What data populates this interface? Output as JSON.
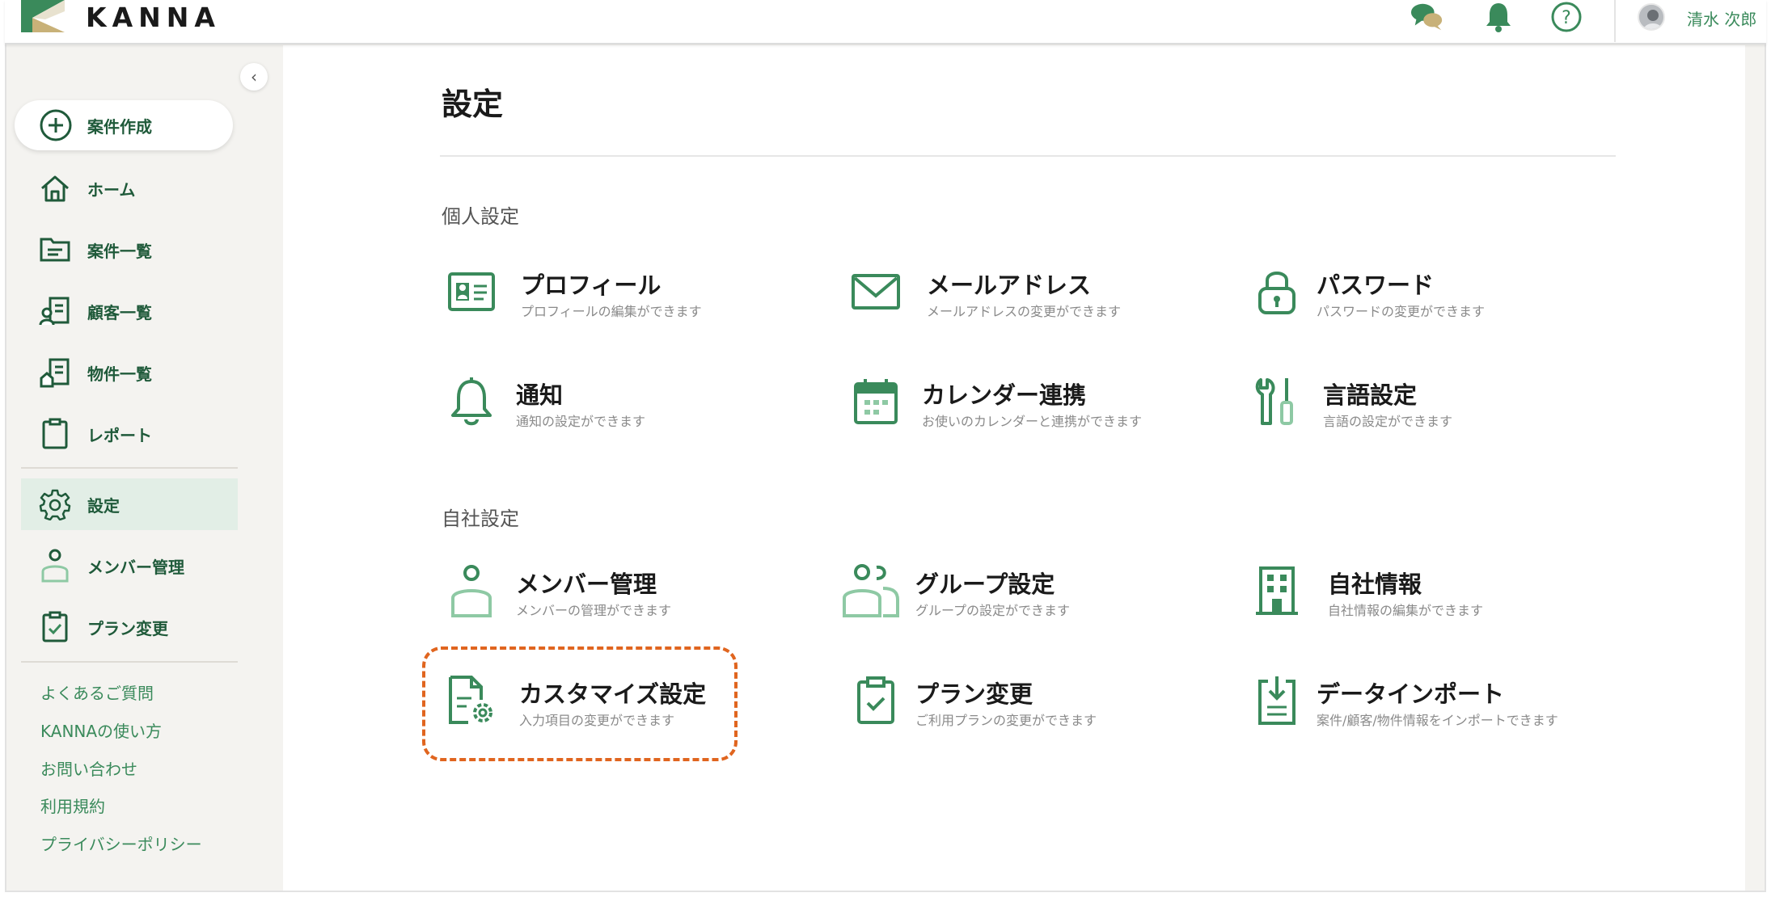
{
  "header": {
    "brand": "KANNA",
    "user_name": "清水 次郎",
    "icons": [
      "chat-icon",
      "bell-icon",
      "help-icon"
    ]
  },
  "sidebar": {
    "collapse_icon": "‹",
    "create_label": "案件作成",
    "items": [
      {
        "label": "ホーム",
        "icon": "home-icon"
      },
      {
        "label": "案件一覧",
        "icon": "folder-icon"
      },
      {
        "label": "顧客一覧",
        "icon": "customer-icon"
      },
      {
        "label": "物件一覧",
        "icon": "property-icon"
      },
      {
        "label": "レポート",
        "icon": "clipboard-icon"
      },
      {
        "label": "設定",
        "icon": "gear-icon",
        "active": true
      },
      {
        "label": "メンバー管理",
        "icon": "user-icon"
      },
      {
        "label": "プラン変更",
        "icon": "clipboard-check-icon"
      }
    ],
    "links": [
      "よくあるご質問",
      "KANNAの使い方",
      "お問い合わせ",
      "利用規約",
      "プライバシーポリシー"
    ]
  },
  "main": {
    "title": "設定",
    "personal": {
      "heading": "個人設定",
      "cards": [
        {
          "title": "プロフィール",
          "desc": "プロフィールの編集ができます"
        },
        {
          "title": "メールアドレス",
          "desc": "メールアドレスの変更ができます"
        },
        {
          "title": "パスワード",
          "desc": "パスワードの変更ができます"
        },
        {
          "title": "通知",
          "desc": "通知の設定ができます"
        },
        {
          "title": "カレンダー連携",
          "desc": "お使いのカレンダーと連携ができます"
        },
        {
          "title": "言語設定",
          "desc": "言語の設定ができます"
        }
      ]
    },
    "company": {
      "heading": "自社設定",
      "cards": [
        {
          "title": "メンバー管理",
          "desc": "メンバーの管理ができます"
        },
        {
          "title": "グループ設定",
          "desc": "グループの設定ができます"
        },
        {
          "title": "自社情報",
          "desc": "自社情報の編集ができます"
        },
        {
          "title": "カスタマイズ設定",
          "desc": "入力項目の変更ができます"
        },
        {
          "title": "プラン変更",
          "desc": "ご利用プランの変更ができます"
        },
        {
          "title": "データインポート",
          "desc": "案件/顧客/物件情報をインポートできます"
        }
      ]
    }
  },
  "colors": {
    "accent": "#3a8a5b",
    "accent_light": "#8ec9a4",
    "highlight": "#e0651f",
    "logo_tan": "#c8b178"
  }
}
